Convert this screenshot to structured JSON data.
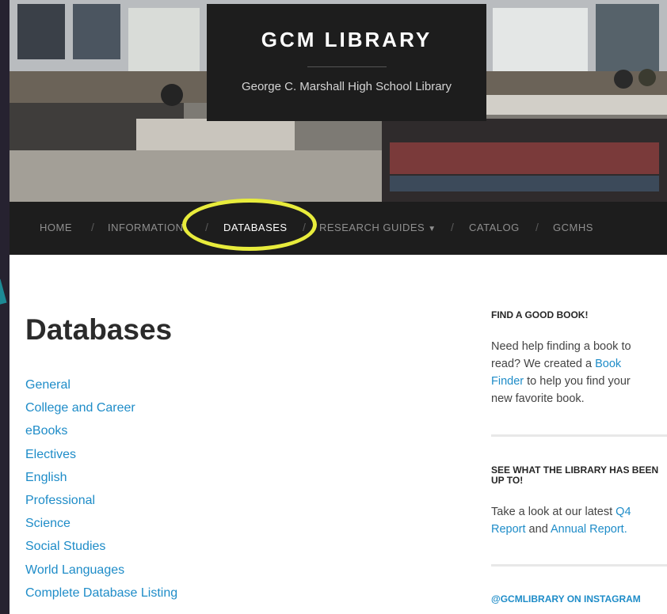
{
  "header": {
    "site_title": "GCM LIBRARY",
    "site_description": "George C. Marshall High School Library"
  },
  "nav": {
    "items": [
      {
        "label": "HOME"
      },
      {
        "label": "INFORMATION"
      },
      {
        "label": "DATABASES"
      },
      {
        "label": "RESEARCH GUIDES"
      },
      {
        "label": "CATALOG"
      },
      {
        "label": "GCMHS"
      }
    ],
    "separator": "/",
    "active": "DATABASES",
    "dropdown_icon": "caret-down-icon",
    "highlight_color": "#e8ec3c"
  },
  "main": {
    "heading": "Databases",
    "databases": [
      "General",
      "College and Career",
      "eBooks",
      "Electives",
      "English",
      "Professional",
      "Science",
      "Social Studies",
      "World Languages",
      "Complete Database Listing"
    ]
  },
  "sidebar": {
    "widget1": {
      "title": "FIND A GOOD BOOK!",
      "text1": "Need help finding a book to read? We created a ",
      "link": "Book Finder",
      "text2": " to help you find your new favorite book."
    },
    "widget2": {
      "title": "SEE WHAT THE LIBRARY HAS BEEN UP TO!",
      "text1": "Take a look at our latest ",
      "link1": "Q4 Report",
      "text2": " and ",
      "link2": "Annual Report",
      "text3": "."
    },
    "widget3": {
      "title": "@GCMLIBRARY ON INSTAGRAM"
    }
  },
  "colors": {
    "link": "#1e8cc8",
    "nav_bg": "#1d1d1d",
    "slide_bg": "#262230",
    "callout": "#1d8a95"
  }
}
